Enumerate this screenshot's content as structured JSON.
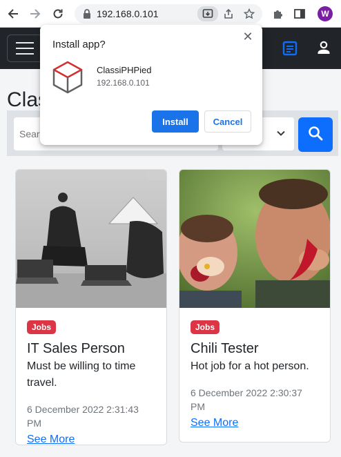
{
  "browser": {
    "url": "192.168.0.101",
    "profile_initial": "W"
  },
  "page": {
    "title_partial": "Clas",
    "search_placeholder": "Searc"
  },
  "listings": [
    {
      "badge": "Jobs",
      "title": "IT Sales Person",
      "description": "Must be willing to time travel.",
      "date": "6 December 2022 2:31:43 PM",
      "link": "See More",
      "image": "samurai-with-laptops-photo"
    },
    {
      "badge": "Jobs",
      "title": "Chili Tester",
      "description": "Hot job for a hot person.",
      "date": "6 December 2022 2:30:37 PM",
      "link": "See More",
      "image": "men-eating-chili-peppers-photo"
    }
  ],
  "install_dialog": {
    "title": "Install app?",
    "app_name": "ClassiPHPied",
    "app_url": "192.168.0.101",
    "install_label": "Install",
    "cancel_label": "Cancel"
  },
  "colors": {
    "navbar": "#212529",
    "primary": "#0d6efd",
    "badge": "#dc3545",
    "chrome_accent": "#1a73e8"
  }
}
